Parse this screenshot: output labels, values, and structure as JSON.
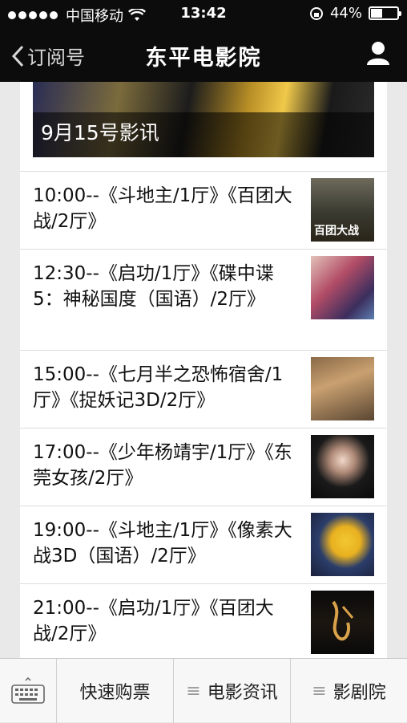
{
  "status": {
    "carrier": "中国移动",
    "time": "13:42",
    "battery": "44%"
  },
  "nav": {
    "back_label": "订阅号",
    "title": "东平电影院"
  },
  "banner": {
    "caption": "9月15号影讯"
  },
  "showings": [
    {
      "text": "10:00--《斗地主/1厅》《百团大战/2厅》",
      "poster": "百团大战"
    },
    {
      "text": "12:30--《启功/1厅》《碟中谍5：神秘国度（国语）/2厅》",
      "poster": ""
    },
    {
      "text": "15:00--《七月半之恐怖宿舍/1厅》《捉妖记3D/2厅》",
      "poster": ""
    },
    {
      "text": "17:00--《少年杨靖宇/1厅》《东莞女孩/2厅》",
      "poster": ""
    },
    {
      "text": "19:00--《斗地主/1厅》《像素大战3D（国语）/2厅》",
      "poster": ""
    },
    {
      "text": "21:00--《启功/1厅》《百团大战/2厅》",
      "poster": ""
    }
  ],
  "tabbar": {
    "tab1": "快速购票",
    "tab2": "电影资讯",
    "tab3": "影剧院"
  },
  "colors": {
    "bar": "#0c0c0c",
    "tabbar": "#f7f7f7"
  }
}
